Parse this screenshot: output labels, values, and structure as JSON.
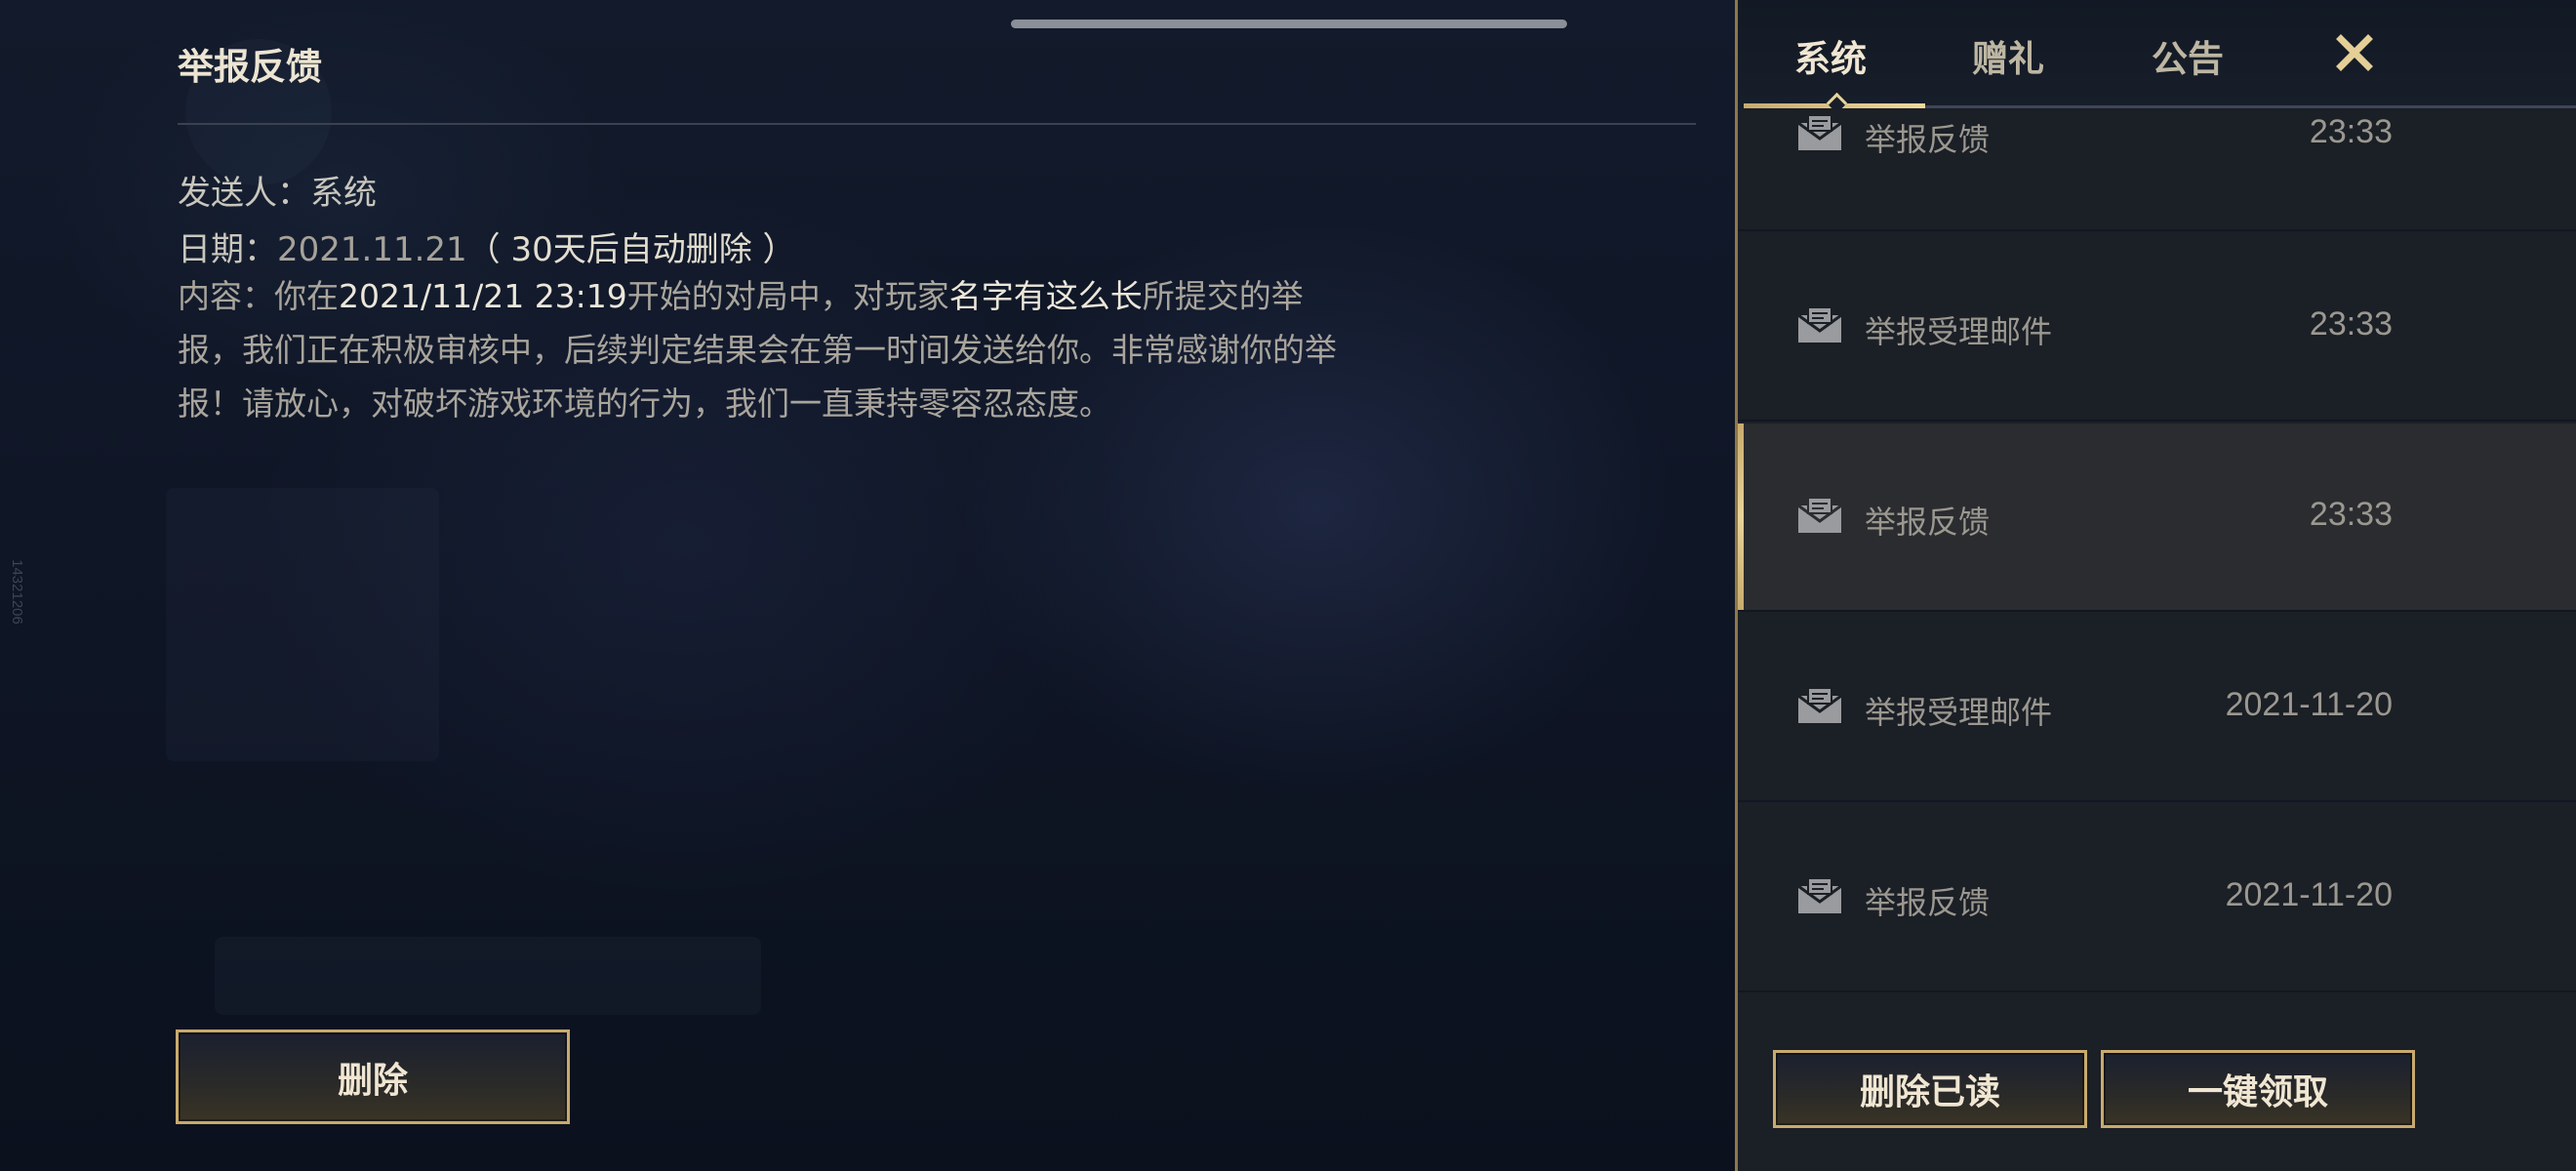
{
  "system": {
    "side_id": "14321206"
  },
  "mail_detail": {
    "title": "举报反馈",
    "sender_label": "发送人：",
    "sender_value": "系统",
    "date_label": "日期：",
    "date_value": "2021.11.21",
    "date_note": "（ 30天后自动删除 ）",
    "content": {
      "label": "内容：",
      "part1": "你在",
      "time_hl": "2021/11/21 23:19",
      "part2": "开始的对局中，对玩家",
      "player_hl": "名字有这么长",
      "part3": "所提交的举报，我们正在积极审核中，后续判定结果会在第一时间发送给你。非常感谢你的举报！请放心，对破坏游戏环境的行为，我们一直秉持零容忍态度。"
    },
    "delete_button": "删除"
  },
  "mailbox": {
    "tabs": [
      {
        "label": "系统",
        "active": true
      },
      {
        "label": "赠礼",
        "active": false
      },
      {
        "label": "公告",
        "active": false
      }
    ],
    "close_icon": "close-icon",
    "items": [
      {
        "name": "举报反馈",
        "time": "23:33",
        "selected": false
      },
      {
        "name": "举报受理邮件",
        "time": "23:33",
        "selected": false
      },
      {
        "name": "举报反馈",
        "time": "23:33",
        "selected": true
      },
      {
        "name": "举报受理邮件",
        "time": "2021-11-20",
        "selected": false
      },
      {
        "name": "举报反馈",
        "time": "2021-11-20",
        "selected": false
      }
    ],
    "delete_read_button": "删除已读",
    "claim_all_button": "一键领取"
  },
  "colors": {
    "gold": "#c8aa6e",
    "gold_text": "#f0e6d2",
    "panel_bg": "#1b1f26",
    "selected_bg": "#2a2c30"
  }
}
